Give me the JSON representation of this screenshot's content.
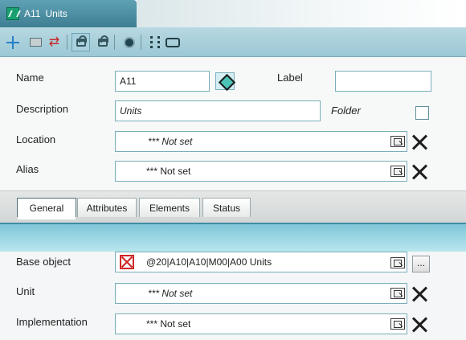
{
  "window": {
    "title_primary": "A11",
    "title_secondary": "Units"
  },
  "toolbar": {
    "icons": [
      "crosshair-icon",
      "folder-icon",
      "arrow-icon",
      "lock-icon",
      "lock-icon",
      "circle-icon",
      "bars-icon",
      "database-icon"
    ]
  },
  "form": {
    "name_label": "Name",
    "name_value": "A11",
    "label_label": "Label",
    "label_value": "",
    "description_label": "Description",
    "description_value": "Units",
    "folder_label": "Folder",
    "location_label": "Location",
    "location_value": "*** Not set",
    "alias_label": "Alias",
    "alias_value": "*** Not set"
  },
  "tabs": {
    "general": "General",
    "attributes": "Attributes",
    "elements": "Elements",
    "status": "Status"
  },
  "general": {
    "base_object_label": "Base object",
    "base_object_value": "@20|A10|A10|M00|A00   Units",
    "ellipsis_label": "...",
    "unit_label": "Unit",
    "unit_value": "*** Not set",
    "implementation_label": "Implementation",
    "implementation_value": "*** Not set"
  },
  "colors": {
    "tab_header": "#3f7f93",
    "toolbar": "#9bc8d4",
    "field_border": "#7aaeb9",
    "error_red": "#cf2525"
  }
}
